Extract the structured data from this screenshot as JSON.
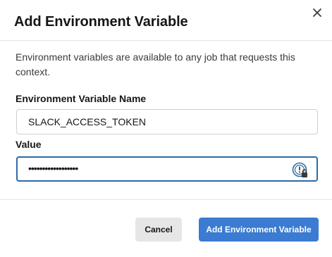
{
  "dialog": {
    "title": "Add Environment Variable",
    "description": "Environment variables are available to any job that requests this context."
  },
  "fields": {
    "name_label": "Environment Variable Name",
    "name_value": "SLACK_ACCESS_TOKEN",
    "value_label": "Value",
    "value_masked": "••••••••••••••••••"
  },
  "buttons": {
    "cancel": "Cancel",
    "submit": "Add Environment Variable"
  },
  "icons": {
    "close": "close-icon",
    "password_manager": "password-manager-icon"
  },
  "colors": {
    "primary": "#3b7bd1",
    "focus_border": "#2d6aa8",
    "cancel_bg": "#e6e6e6"
  }
}
